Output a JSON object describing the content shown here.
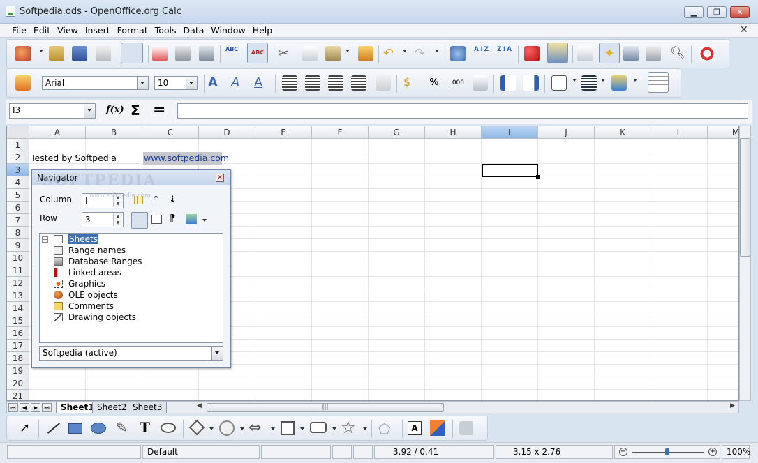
{
  "window": {
    "title": "Softpedia.ods - OpenOffice.org Calc"
  },
  "menu": [
    "File",
    "Edit",
    "View",
    "Insert",
    "Format",
    "Tools",
    "Data",
    "Window",
    "Help"
  ],
  "format_toolbar": {
    "font_name": "Arial",
    "font_size": "10",
    "percent_label": "%",
    "decimal_label": ".000"
  },
  "formula_bar": {
    "cell_ref": "I3",
    "function_label": "f(x)",
    "sum_label": "Σ",
    "equals_label": "="
  },
  "grid": {
    "columns": [
      "A",
      "B",
      "C",
      "D",
      "E",
      "F",
      "G",
      "H",
      "I",
      "J",
      "K",
      "L",
      "M"
    ],
    "rows": [
      "1",
      "2",
      "3",
      "4",
      "5",
      "6",
      "7",
      "8",
      "9",
      "10",
      "11",
      "12",
      "13",
      "14",
      "15",
      "16",
      "17",
      "18",
      "19",
      "20",
      "21"
    ],
    "selected_column": "I",
    "selected_row": "3",
    "cells": {
      "A2": "Tested by Softpedia",
      "C2": "www.softpedia.com"
    }
  },
  "sheets": [
    "Sheet1",
    "Sheet2",
    "Sheet3"
  ],
  "active_sheet": "Sheet1",
  "scroll_grip": "|||",
  "navigator": {
    "title": "Navigator",
    "column_label": "Column",
    "column_value": "I",
    "row_label": "Row",
    "row_value": "3",
    "tree": [
      "Sheets",
      "Range names",
      "Database Ranges",
      "Linked areas",
      "Graphics",
      "OLE objects",
      "Comments",
      "Drawing objects"
    ],
    "document": "Softpedia (active)",
    "watermark": "SOFTPEDIA",
    "watermark_sub": "www.softpedia.com"
  },
  "status": {
    "page_style": "Default",
    "position": "3.92 / 0.41",
    "size": "3.15 x 2.76",
    "zoom": "100%"
  },
  "colors": {
    "accent": "#3d6fb4",
    "selection_header": "#8fb7e6",
    "link": "#1a3a9a"
  }
}
